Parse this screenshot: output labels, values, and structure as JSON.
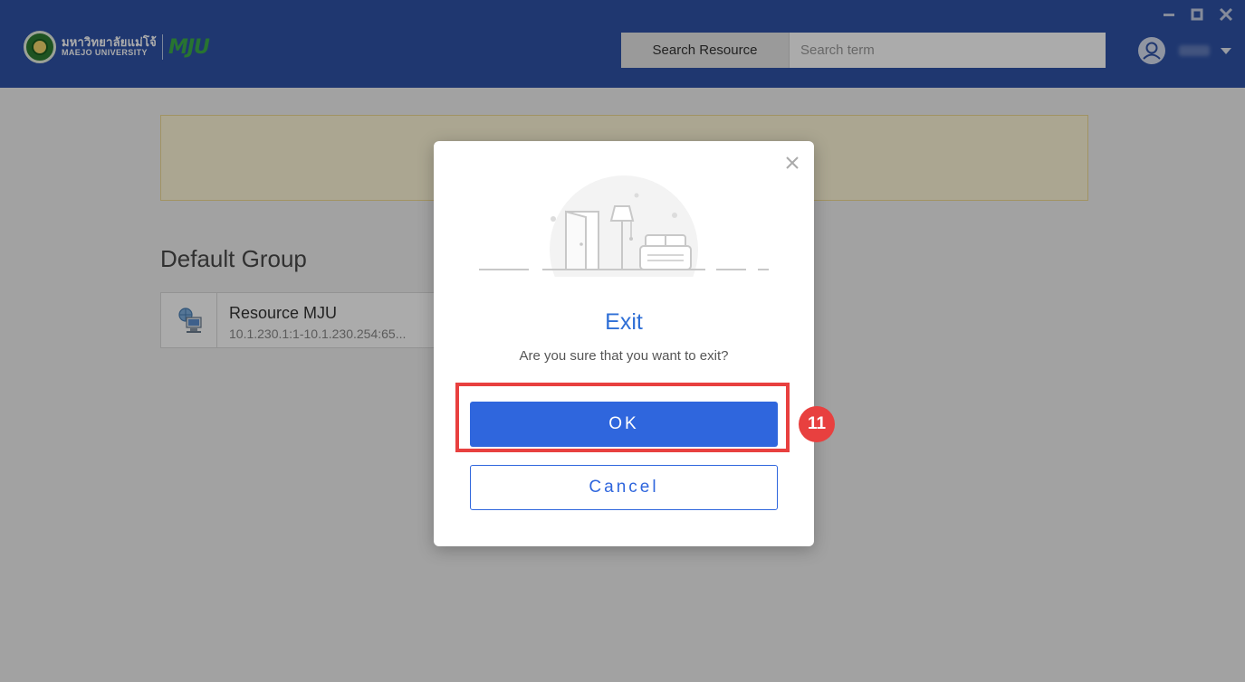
{
  "header": {
    "logo": {
      "thai_name": "มหาวิทยาลัยแม่โจ้",
      "english_name": "MAEJO UNIVERSITY",
      "abbreviation": "MJU"
    },
    "search": {
      "type_label": "Search Resource",
      "placeholder": "Search term",
      "value": ""
    },
    "user": {
      "avatar_icon": "user-circle-icon",
      "dropdown_icon": "caret-down-icon"
    },
    "window_controls": {
      "minimize_icon": "minimize-icon",
      "maximize_icon": "maximize-icon",
      "close_icon": "close-icon"
    }
  },
  "main": {
    "group_title": "Default Group",
    "resources": [
      {
        "name": "Resource MJU",
        "address": "10.1.230.1:1-10.1.230.254:65...",
        "icon": "network-computer-icon"
      }
    ]
  },
  "dialog": {
    "title": "Exit",
    "message": "Are you sure that you want to exit?",
    "ok_label": "OK",
    "cancel_label": "Cancel",
    "close_icon": "close-icon",
    "illustration": "room-door-lamp-sofa-illustration"
  },
  "annotation": {
    "step_number": "11",
    "color": "#e8403f"
  },
  "colors": {
    "header_bg": "#2f53a8",
    "primary": "#2f66dd",
    "title": "#2f6fd6",
    "notice_bg": "#fff8d9"
  }
}
